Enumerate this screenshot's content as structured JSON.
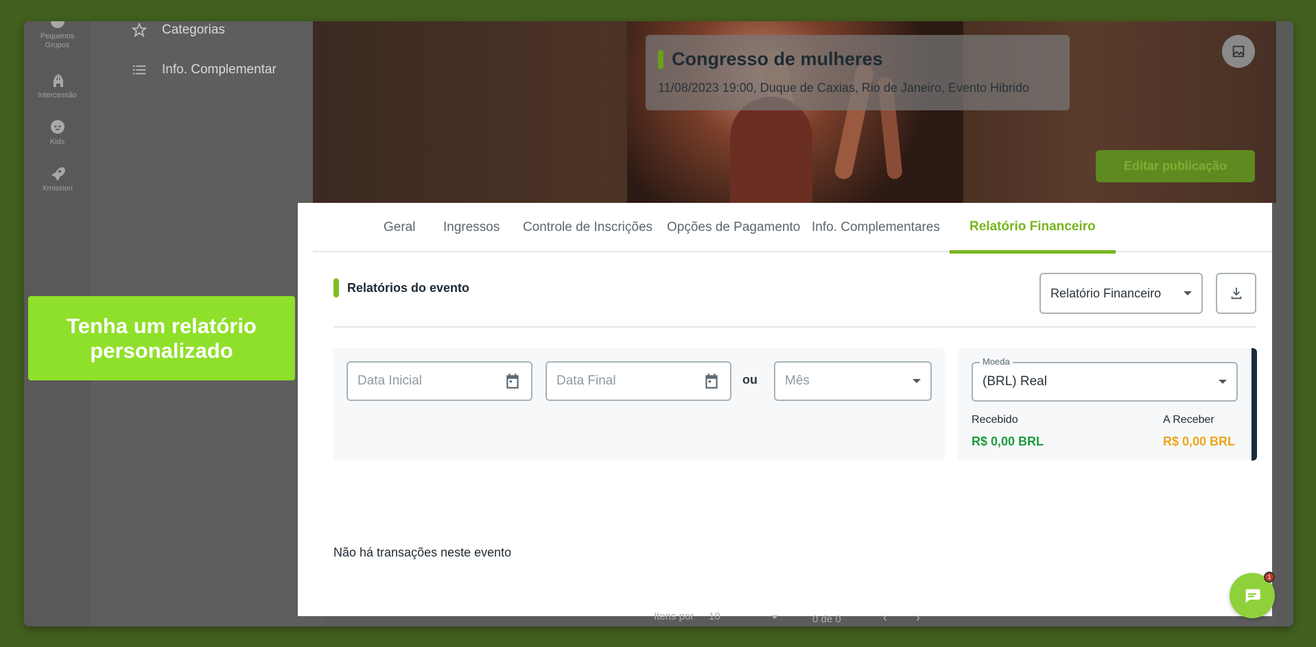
{
  "rail": {
    "items": [
      {
        "label": "Pequenos Grupos",
        "icon": "group-icon"
      },
      {
        "label": "Intercessão",
        "icon": "praying-hands-icon"
      },
      {
        "label": "Kids",
        "icon": "child-face-icon"
      },
      {
        "label": "Xmission",
        "icon": "rocket-icon"
      }
    ]
  },
  "submenu": {
    "items": [
      {
        "label": "Categorias",
        "icon": "star-icon"
      },
      {
        "label": "Info. Complementar",
        "icon": "list-icon"
      }
    ]
  },
  "event": {
    "title": "Congresso de mulheres",
    "details": "11/08/2023 19:00, Duque de Caxias, Rio de Janeiro, Evento Hibrido",
    "edit_label": "Editar publicação"
  },
  "tabs": [
    {
      "label": "Geral"
    },
    {
      "label": "Ingressos"
    },
    {
      "label": "Controle de Inscrições"
    },
    {
      "label": "Opções de Pagamento"
    },
    {
      "label": "Info. Complementares"
    },
    {
      "label": "Relatório Financeiro",
      "active": true
    }
  ],
  "report": {
    "section_title": "Relatórios do evento",
    "selected_report": "Relatório Financeiro",
    "filters": {
      "start_placeholder": "Data Inicial",
      "end_placeholder": "Data Final",
      "or_label": "ou",
      "month_placeholder": "Mês"
    },
    "currency": {
      "label": "Moeda",
      "value": "(BRL) Real"
    },
    "received": {
      "label": "Recebido",
      "value": "R$ 0,00 BRL",
      "color": "#1f9a3c"
    },
    "receivable": {
      "label": "A Receber",
      "value": "R$ 0,00 BRL",
      "color": "#f0a41c"
    },
    "empty_message": "Não há transações neste evento"
  },
  "pager": {
    "items_per_page_label": "Itens por",
    "items_per_page_value": "10",
    "range": "0 de 0"
  },
  "cta": {
    "text": "Tenha um relatório personalizado"
  },
  "chat": {
    "badge": "1"
  },
  "colors": {
    "accent": "#77b51d",
    "cta": "#8fe02a",
    "background": "#43601f"
  }
}
